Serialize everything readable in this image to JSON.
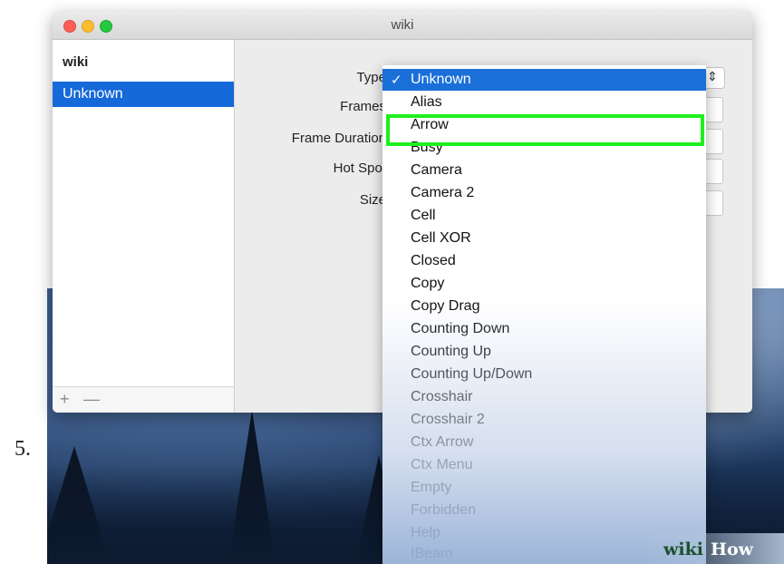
{
  "step_number": "5.",
  "window": {
    "title": "wiki"
  },
  "sidebar": {
    "header": "wiki",
    "items": [
      {
        "label": "Unknown",
        "selected": true
      }
    ],
    "add_label": "+",
    "remove_label": "—"
  },
  "form": {
    "labels": [
      "Type",
      "Frames",
      "Frame Duration",
      "Hot Spot",
      "Size"
    ]
  },
  "popup": {
    "selected": "Unknown",
    "items": [
      "Unknown",
      "Alias",
      "Arrow",
      "Busy",
      "Camera",
      "Camera 2",
      "Cell",
      "Cell XOR",
      "Closed",
      "Copy",
      "Copy Drag",
      "Counting Down",
      "Counting Up",
      "Counting Up/Down",
      "Crosshair",
      "Crosshair 2",
      "Ctx Arrow",
      "Ctx Menu",
      "Empty",
      "Forbidden",
      "Help",
      "IBeam"
    ],
    "highlighted": "Arrow"
  },
  "watermark": {
    "part1": "wiki",
    "part2": "How"
  },
  "colors": {
    "selection": "#1b6fd9",
    "highlight_box": "#1ef01e"
  }
}
